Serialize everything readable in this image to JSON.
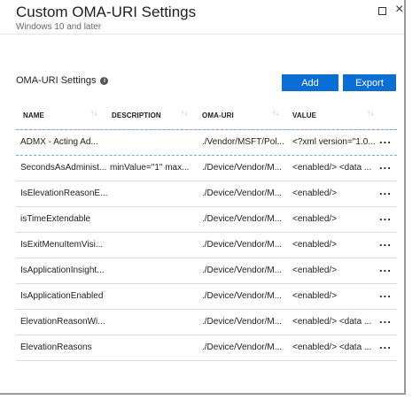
{
  "header": {
    "title": "Custom OMA-URI Settings",
    "subtitle": "Windows 10 and later"
  },
  "section": {
    "label": "OMA-URI Settings",
    "add_label": "Add",
    "export_label": "Export"
  },
  "table": {
    "columns": [
      "NAME",
      "DESCRIPTION",
      "OMA-URI",
      "VALUE"
    ],
    "rows": [
      {
        "name": "ADMX - Acting Ad...",
        "description": "",
        "uri": "./Vendor/MSFT/Pol...",
        "value": "<?xml version=\"1.0..."
      },
      {
        "name": "SecondsAsAdminist...",
        "description": "minValue=\"1\" max...",
        "uri": "./Device/Vendor/M...",
        "value": "<enabled/> <data ..."
      },
      {
        "name": "IsElevationReasonE...",
        "description": "",
        "uri": "./Device/Vendor/M...",
        "value": "<enabled/>"
      },
      {
        "name": "isTimeExtendable",
        "description": "",
        "uri": "./Device/Vendor/M...",
        "value": "<enabled/>"
      },
      {
        "name": "IsExitMenuItemVisi...",
        "description": "",
        "uri": "./Device/Vendor/M...",
        "value": "<enabled/>"
      },
      {
        "name": "IsApplicationInsight...",
        "description": "",
        "uri": "./Device/Vendor/M...",
        "value": "<enabled/>"
      },
      {
        "name": "IsApplicationEnabled",
        "description": "",
        "uri": "./Device/Vendor/M...",
        "value": "<enabled/>"
      },
      {
        "name": "ElevationReasonWi...",
        "description": "",
        "uri": "./Device/Vendor/M...",
        "value": "<enabled/> <data ..."
      },
      {
        "name": "ElevationReasons",
        "description": "",
        "uri": "./Device/Vendor/M...",
        "value": "<enabled/> <data ..."
      }
    ],
    "more_glyph": "..."
  },
  "icons": {
    "maximize": "maximize-icon",
    "close": "close-icon",
    "info": "info-icon",
    "sort": "sort-icon",
    "more": "more-icon"
  },
  "colors": {
    "accent": "#0b6ed5",
    "selected_border": "#7aa8d8"
  }
}
